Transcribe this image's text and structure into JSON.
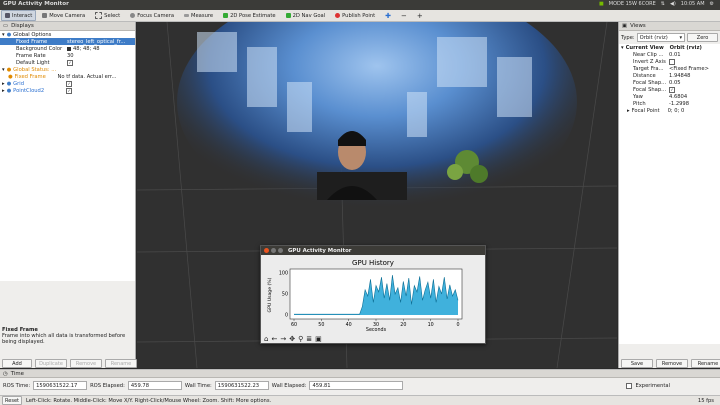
{
  "window": {
    "title": "GPU Activity Monitor",
    "tray": {
      "mode": "MODE 15W 6CORE",
      "time": "10:05 AM"
    }
  },
  "toolbar": {
    "items": [
      "Interact",
      "Move Camera",
      "Select",
      "Focus Camera",
      "Measure",
      "2D Pose Estimate",
      "2D Nav Goal",
      "Publish Point"
    ]
  },
  "displays": {
    "title": "Displays",
    "rows": [
      {
        "key": "Global Options",
        "value": ""
      },
      {
        "key": "Fixed Frame",
        "value": "stereo_left_optical_fr..."
      },
      {
        "key": "Background Color",
        "value": "48; 48; 48"
      },
      {
        "key": "Frame Rate",
        "value": "30"
      },
      {
        "key": "Default Light",
        "value": ""
      },
      {
        "key": "Global Status: ...",
        "value": ""
      },
      {
        "key": "Fixed Frame",
        "value": "No tf data.  Actual err..."
      },
      {
        "key": "Grid",
        "value": ""
      },
      {
        "key": "PointCloud2",
        "value": ""
      }
    ],
    "desc_title": "Fixed Frame",
    "desc_text": "Frame into which all data is transformed before being displayed.",
    "buttons": [
      "Add",
      "Duplicate",
      "Remove",
      "Rename"
    ]
  },
  "views": {
    "title": "Views",
    "type_label": "Type:",
    "type_value": "Orbit (rviz)",
    "zero": "Zero",
    "current_view": {
      "key": "Current View",
      "value": "Orbit (rviz)"
    },
    "rows": [
      {
        "key": "Near Clip ...",
        "value": "0.01"
      },
      {
        "key": "Invert Z Axis",
        "value": ""
      },
      {
        "key": "Target Fra...",
        "value": "<Fixed Frame>"
      },
      {
        "key": "Distance",
        "value": "1.94848"
      },
      {
        "key": "Focal Shap...",
        "value": "0.05"
      },
      {
        "key": "Focal Shap...",
        "value": ""
      },
      {
        "key": "Yaw",
        "value": "4.6804"
      },
      {
        "key": "Pitch",
        "value": "-1.2998"
      },
      {
        "key": "Focal Point",
        "value": "0; 0; 0"
      }
    ],
    "buttons": [
      "Save",
      "Remove",
      "Rename"
    ]
  },
  "gpu": {
    "title": "GPU Activity Monitor",
    "chart_data": {
      "type": "line",
      "title": "GPU History",
      "xlabel": "Seconds",
      "ylabel": "GPU Usage (%)",
      "xlim": [
        60,
        0
      ],
      "ylim": [
        0,
        100
      ],
      "xticks": [
        "60",
        "50",
        "40",
        "30",
        "20",
        "10",
        "0"
      ],
      "yticks": [
        "100",
        "50",
        "0"
      ],
      "x": [
        60,
        58,
        56,
        54,
        52,
        50,
        48,
        46,
        44,
        42,
        40,
        38,
        36,
        35,
        34,
        33,
        32,
        31,
        30,
        29,
        28,
        27,
        26,
        25,
        24,
        23,
        22,
        21,
        20,
        19,
        18,
        17,
        16,
        15,
        14,
        13,
        12,
        11,
        10,
        9,
        8,
        7,
        6,
        5,
        4,
        3,
        2,
        1,
        0
      ],
      "values": [
        2,
        2,
        2,
        2,
        2,
        2,
        2,
        2,
        2,
        2,
        2,
        2,
        2,
        20,
        60,
        45,
        85,
        30,
        70,
        55,
        90,
        40,
        75,
        35,
        95,
        50,
        65,
        30,
        80,
        45,
        88,
        25,
        70,
        55,
        92,
        35,
        60,
        78,
        40,
        85,
        30,
        68,
        50,
        90,
        38,
        72,
        45,
        60,
        35
      ]
    },
    "toolbar_icons": [
      "home-icon",
      "back-icon",
      "forward-icon",
      "pan-icon",
      "zoom-icon",
      "configure-icon",
      "save-icon"
    ]
  },
  "time": {
    "title": "Time",
    "ros_time_label": "ROS Time:",
    "ros_time": "1590631522.17",
    "ros_elapsed_label": "ROS Elapsed:",
    "ros_elapsed": "459.78",
    "wall_time_label": "Wall Time:",
    "wall_time": "1590631522.23",
    "wall_elapsed_label": "Wall Elapsed:",
    "wall_elapsed": "459.81",
    "experimental": "Experimental"
  },
  "status": {
    "reset": "Reset",
    "hint": "Left-Click: Rotate. Middle-Click: Move X/Y. Right-Click/Mouse Wheel: Zoom. Shift: More options.",
    "fps": "15 fps"
  },
  "colors": {
    "accent": "#3e7cc7",
    "series": "#1ea3d6",
    "viewport_bg": "#303030"
  }
}
